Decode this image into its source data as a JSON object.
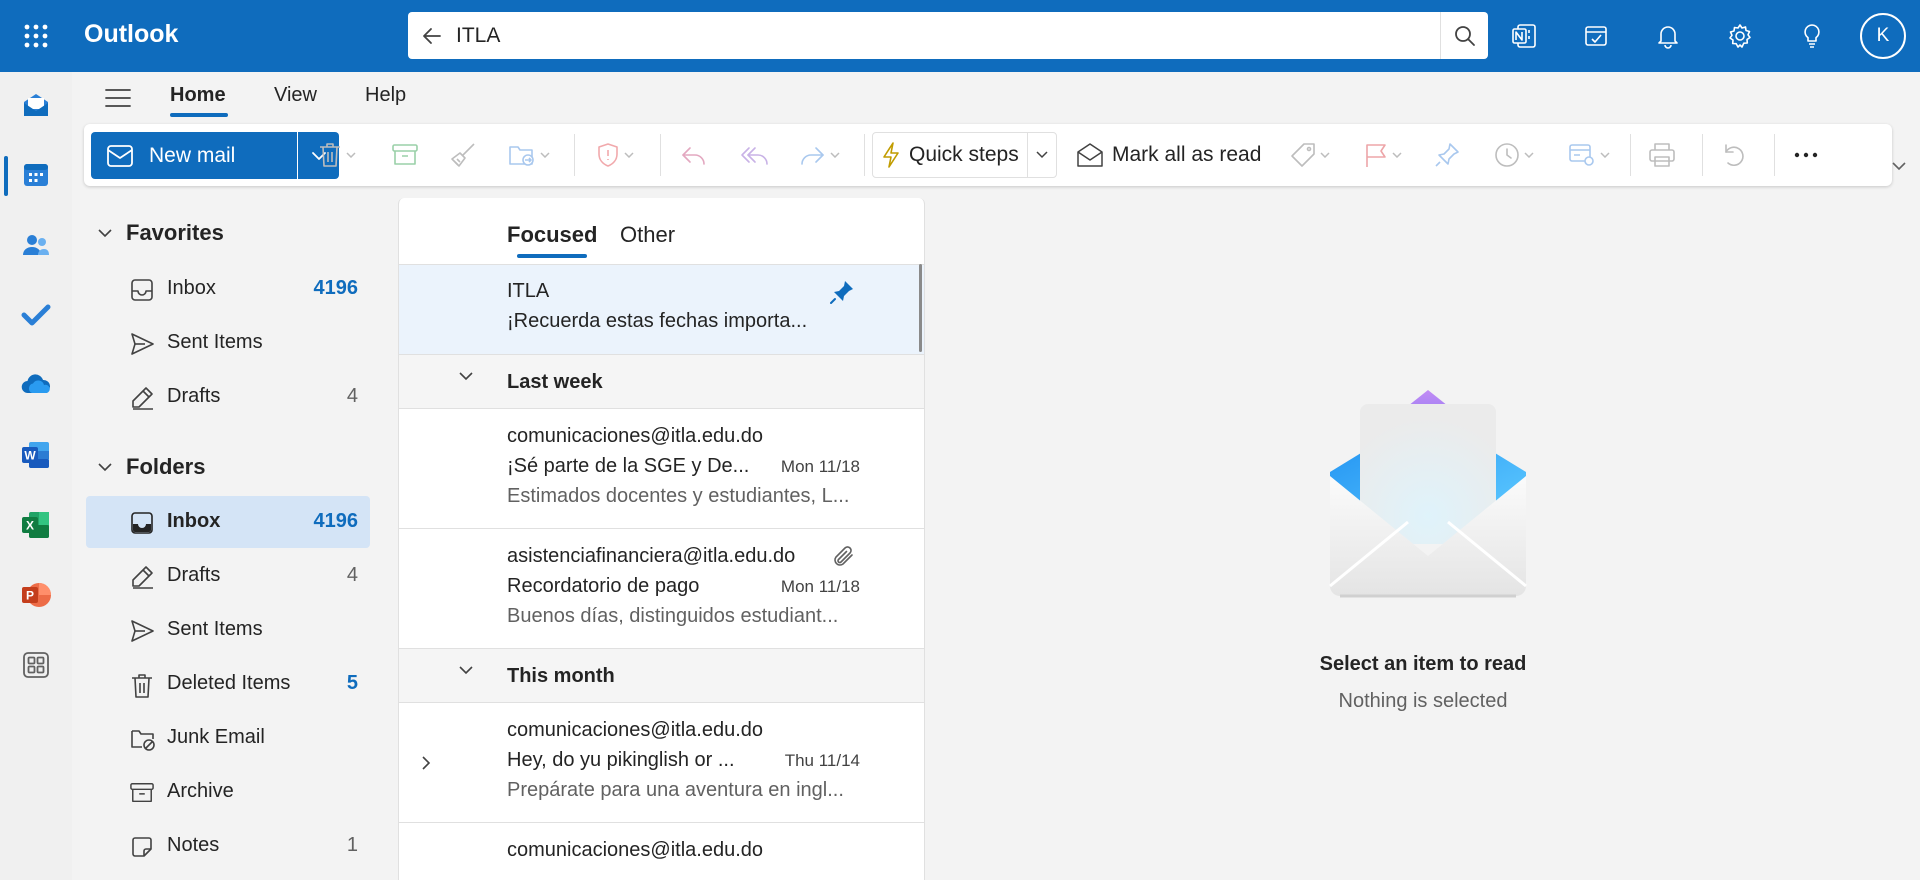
{
  "app": {
    "name": "Outlook",
    "user_initial": "K"
  },
  "search": {
    "value": "ITLA"
  },
  "menu": {
    "tabs": [
      {
        "label": "Home"
      },
      {
        "label": "View"
      },
      {
        "label": "Help"
      }
    ]
  },
  "ribbon": {
    "new_mail": "New mail",
    "quick_steps": "Quick steps",
    "mark_all_read": "Mark all as read"
  },
  "nav": {
    "favorites": {
      "label": "Favorites",
      "items": [
        {
          "label": "Inbox",
          "count": "4196"
        },
        {
          "label": "Sent Items",
          "count": ""
        },
        {
          "label": "Drafts",
          "count": "4"
        }
      ]
    },
    "folders": {
      "label": "Folders",
      "items": [
        {
          "label": "Inbox",
          "count": "4196"
        },
        {
          "label": "Drafts",
          "count": "4"
        },
        {
          "label": "Sent Items",
          "count": ""
        },
        {
          "label": "Deleted Items",
          "count": "5"
        },
        {
          "label": "Junk Email",
          "count": ""
        },
        {
          "label": "Archive",
          "count": ""
        },
        {
          "label": "Notes",
          "count": "1"
        }
      ]
    }
  },
  "list": {
    "tabs": [
      {
        "label": "Focused"
      },
      {
        "label": "Other"
      }
    ],
    "pinned": {
      "from": "ITLA",
      "subject": "¡Recuerda estas fechas importa..."
    },
    "groups": [
      {
        "label": "Last week"
      },
      {
        "label": "This month"
      }
    ],
    "messages": [
      {
        "from": "comunicaciones@itla.edu.do",
        "subject": "¡Sé parte de la SGE y De...",
        "date": "Mon 11/18",
        "preview": "Estimados docentes y estudiantes, L..."
      },
      {
        "from": "asistenciafinanciera@itla.edu.do",
        "subject": "Recordatorio de pago",
        "date": "Mon 11/18",
        "preview": "Buenos días, distinguidos estudiant..."
      },
      {
        "from": "comunicaciones@itla.edu.do",
        "subject": "Hey, do yu pikinglish or ...",
        "date": "Thu 11/14",
        "preview": "Prepárate para una aventura en ingl..."
      },
      {
        "from": "comunicaciones@itla.edu.do"
      }
    ]
  },
  "reading": {
    "title": "Select an item to read",
    "subtitle": "Nothing is selected"
  },
  "colors": {
    "brand": "#0f6cbd",
    "selected_bg": "#d4e4f6",
    "list_selected_bg": "#ebf3fc"
  }
}
